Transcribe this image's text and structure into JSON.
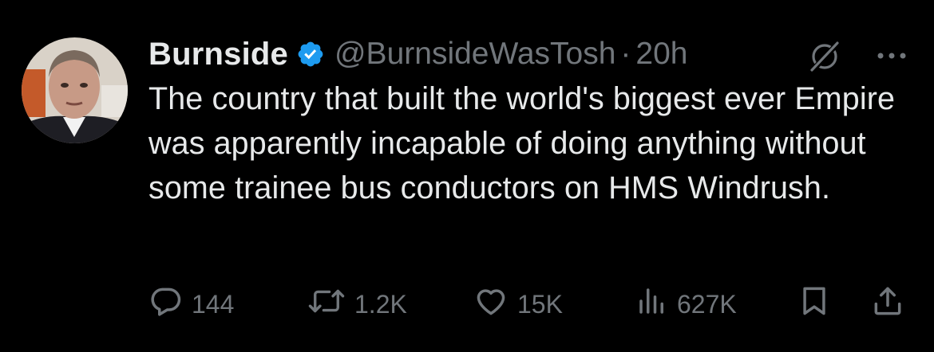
{
  "tweet": {
    "display_name": "Burnside",
    "handle": "@BurnsideWasTosh",
    "separator": "·",
    "time": "20h",
    "text": "The country that built the world's biggest ever Empire was apparently incapable of doing anything without some trainee bus conductors on HMS Windrush.",
    "verified": true
  },
  "actions": {
    "replies": "144",
    "retweets": "1.2K",
    "likes": "15K",
    "views": "627K"
  },
  "icons": {
    "verified": "verified-badge-icon",
    "grok": "grok-icon",
    "more": "more-icon",
    "reply": "reply-icon",
    "retweet": "retweet-icon",
    "like": "heart-icon",
    "views": "views-icon",
    "bookmark": "bookmark-icon",
    "share": "share-icon"
  },
  "colors": {
    "background": "#000000",
    "text": "#e7e9ea",
    "secondary": "#71767b",
    "verified": "#1d9bf0"
  }
}
